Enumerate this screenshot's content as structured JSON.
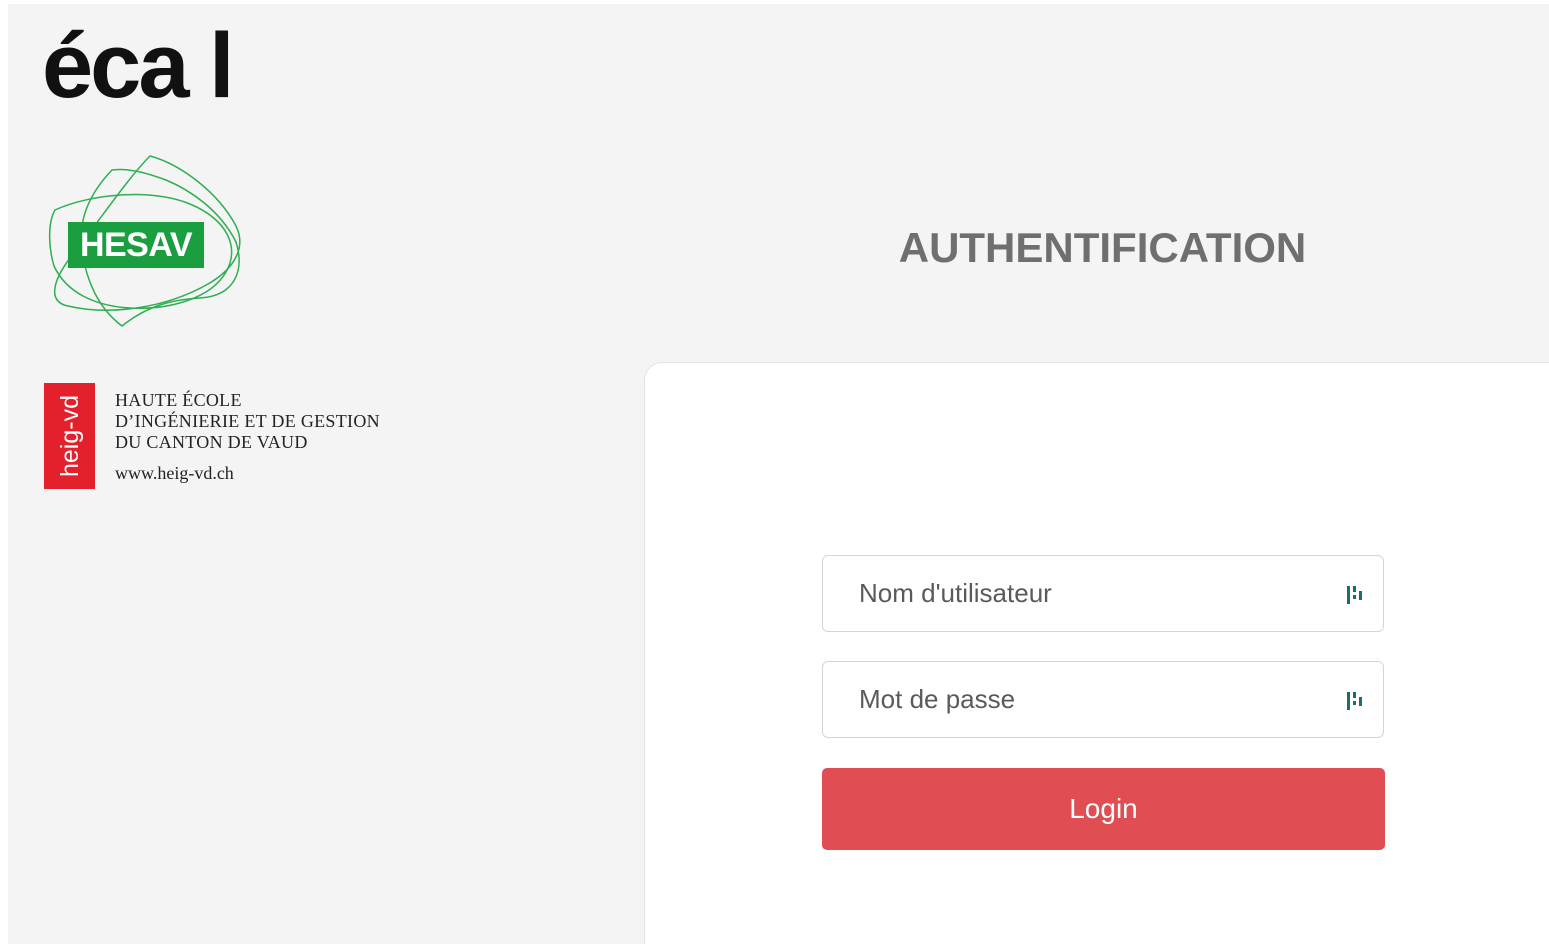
{
  "branding": {
    "ecal_logo_text": "éca l",
    "hesav_logo_text": "HESAV",
    "heig": {
      "badge_text": "heig-vd",
      "lines": [
        "HAUTE ÉCOLE",
        "D’INGÉNIERIE ET DE GESTION",
        "DU CANTON DE VAUD"
      ],
      "url": "www.heig-vd.ch"
    }
  },
  "login": {
    "title": "AUTHENTIFICATION",
    "username_placeholder": "Nom d'utilisateur",
    "password_placeholder": "Mot de passe",
    "submit_label": "Login"
  },
  "colors": {
    "page_background": "#f4f4f4",
    "hesav_green": "#1a9e3f",
    "heig_red": "#e3202b",
    "login_button": "#e04d53",
    "title_gray": "#6f6f6f",
    "field_icon": "#1b6f6a"
  },
  "icons": {
    "field_icon": "password-manager-icon"
  }
}
